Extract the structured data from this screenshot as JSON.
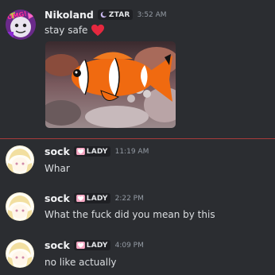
{
  "messages": [
    {
      "username": "Nikoland",
      "tag": "ZTAR",
      "time": "3:52 AM",
      "text": "stay safe",
      "emoji": "heart-emoji",
      "avatar_text": "OMG!",
      "attachment": "clownfish-image"
    },
    {
      "username": "sock",
      "tag": "LADY",
      "time": "11:19 AM",
      "text": "Whar"
    },
    {
      "username": "sock",
      "tag": "LADY",
      "time": "2:22 PM",
      "text": "What the fuck did you mean by this"
    },
    {
      "username": "sock",
      "tag": "LADY",
      "time": "4:09 PM",
      "text": "no like actually"
    }
  ],
  "colors": {
    "background": "#2b2d31",
    "new_messages_divider": "#a83a3a",
    "heart": "#e5283f",
    "lady_tag_icon": "#f7a8c4"
  }
}
